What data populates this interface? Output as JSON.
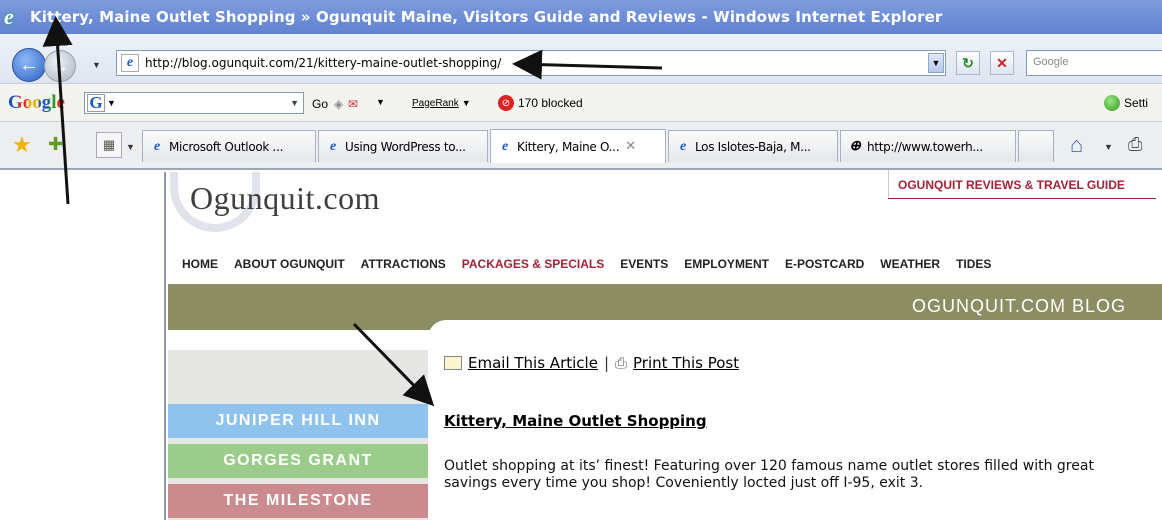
{
  "window": {
    "title": "Kittery, Maine Outlet Shopping » Ogunquit Maine, Visitors Guide and Reviews - Windows Internet Explorer"
  },
  "address_bar": {
    "url": "http://blog.ogunquit.com/21/kittery-maine-outlet-shopping/"
  },
  "search": {
    "placeholder": "Google"
  },
  "google_toolbar": {
    "logo": "Google",
    "go_label": "Go",
    "pagerank_label": "PageRank",
    "blocked_label": "170 blocked",
    "settings_label": "Setti"
  },
  "tabs": [
    {
      "label": "Microsoft Outlook ..."
    },
    {
      "label": "Using WordPress to..."
    },
    {
      "label": "Kittery, Maine O..."
    },
    {
      "label": "Los Islotes-Baja, M..."
    },
    {
      "label": "http://www.towerh..."
    }
  ],
  "site": {
    "logo": "Ogunquit.com",
    "guide_link": "OGUNQUIT REVIEWS & TRAVEL GUIDE",
    "nav": [
      "HOME",
      "ABOUT OGUNQUIT",
      "ATTRACTIONS",
      "PACKAGES & SPECIALS",
      "EVENTS",
      "EMPLOYMENT",
      "E-POSTCARD",
      "WEATHER",
      "TIDES"
    ],
    "blog_title": "OGUNQUIT.COM BLOG",
    "sidebar": [
      {
        "label": "JUNIPER HILL INN",
        "color": "#8fc3ee"
      },
      {
        "label": "GORGES GRANT",
        "color": "#9ccc8b"
      },
      {
        "label": "THE MILESTONE",
        "color": "#c98b8e"
      }
    ],
    "email_link": "Email This Article",
    "print_link": "Print This Post",
    "separator": "|",
    "article_title": "Kittery, Maine Outlet Shopping",
    "article_body": "Outlet shopping at its’ finest! Featuring over 120 famous name outlet stores filled with great savings every time you shop! Coveniently locted just off I-95, exit 3."
  },
  "colors": {
    "accent": "#a52236",
    "blog_band": "#8d8d63",
    "title_bar": "#6b8bd6"
  }
}
